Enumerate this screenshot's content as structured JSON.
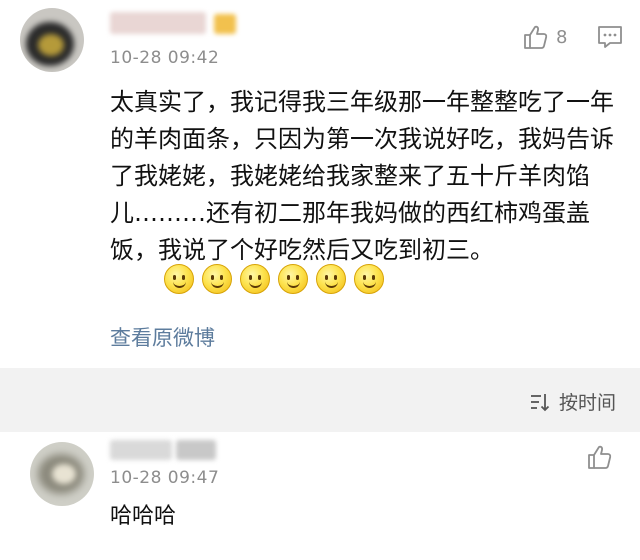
{
  "comments": [
    {
      "timestamp": "10-28 09:42",
      "like_count": "8",
      "text": "太真实了，我记得我三年级那一年整整吃了一年的羊肉面条，只因为第一次我说好吃，我妈告诉了我姥姥，我姥姥给我家整来了五十斤羊肉馅儿………还有初二那年我妈做的西红柿鸡蛋盖饭，我说了个好吃然后又吃到初三。",
      "emoji_count": 6,
      "view_original_label": "查看原微博"
    },
    {
      "timestamp": "10-28 09:47",
      "text": "哈哈哈"
    }
  ],
  "sort": {
    "label": "按时间",
    "icon": "sort-icon"
  },
  "colors": {
    "link": "#5d7c9d",
    "timestamp": "#8d8d8d",
    "divider_bg": "#f2f2f2"
  }
}
